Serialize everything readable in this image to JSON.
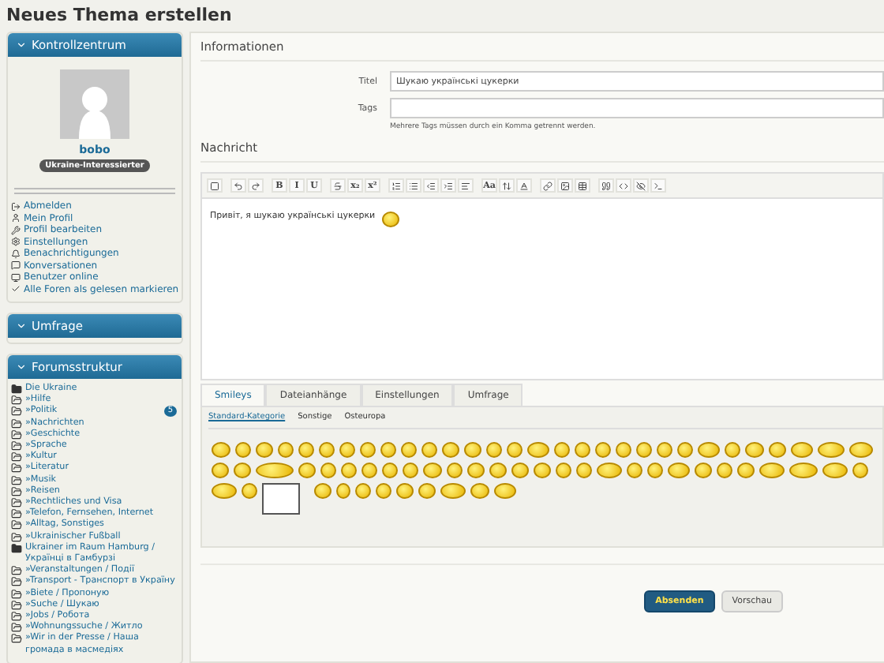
{
  "page_title": "Neues Thema erstellen",
  "control_center": {
    "title": "Kontrollzentrum",
    "username": "bobo",
    "rank": "Ukraine-Interessierter",
    "links": [
      {
        "kind": "logout",
        "label": "Abmelden"
      },
      {
        "kind": "profile",
        "label": "Mein Profil"
      },
      {
        "kind": "edit",
        "label": "Profil bearbeiten"
      },
      {
        "kind": "settings",
        "label": "Einstellungen"
      },
      {
        "kind": "bell",
        "label": "Benachrichtigungen"
      },
      {
        "kind": "chat",
        "label": "Konversationen"
      },
      {
        "kind": "monitor",
        "label": "Benutzer online"
      },
      {
        "kind": "check",
        "label": "Alle Foren als gelesen markieren"
      }
    ]
  },
  "poll_box": {
    "title": "Umfrage"
  },
  "forum_structure": {
    "title": "Forumsstruktur",
    "items": [
      {
        "label": "Die Ukraine",
        "children": [
          {
            "label": "»Hilfe"
          },
          {
            "label": "»Politik",
            "badge": "5"
          },
          {
            "label": "»Nachrichten"
          },
          {
            "label": "»Geschichte"
          },
          {
            "label": "»Sprache"
          },
          {
            "label": "»Kultur"
          },
          {
            "label": "»Literatur"
          },
          {
            "label": "»Musik"
          },
          {
            "label": "»Reisen"
          },
          {
            "label": "»Rechtliches und Visa"
          },
          {
            "label": "»Telefon, Fernsehen, Internet"
          },
          {
            "label": "»Alltag, Sonstiges"
          },
          {
            "label": "»Ukrainischer Fußball"
          }
        ]
      },
      {
        "label": "Ukrainer im Raum Hamburg / Українці в Гамбурзі",
        "children": [
          {
            "label": "»Veranstaltungen / Події"
          },
          {
            "label": "»Transport - Транспорт в Україну"
          },
          {
            "label": "»Biete / Пропоную"
          },
          {
            "label": "»Suche / Шукаю"
          },
          {
            "label": "»Jobs / Робота"
          },
          {
            "label": "»Wohnungssuche / Житло"
          },
          {
            "label": "»Wir in der Presse / Наша громада в масмедіях"
          }
        ]
      }
    ]
  },
  "information": {
    "heading": "Informationen",
    "fields": [
      {
        "label": "Titel",
        "value": "Шукаю українські цукерки"
      },
      {
        "label": "Tags"
      }
    ],
    "hint": "Mehrere Tags müssen durch ein Komma getrennt werden."
  },
  "message": {
    "heading": "Nachricht",
    "text": "Привіт, я шукаю українські цукерки",
    "toolbar": [
      [
        {
          "kind": "source"
        }
      ],
      [
        {
          "kind": "undo"
        },
        {
          "kind": "redo"
        }
      ],
      [
        {
          "kind": "text",
          "label": "B"
        },
        {
          "kind": "text",
          "label": "I"
        },
        {
          "kind": "text",
          "label": "U"
        }
      ],
      [
        {
          "kind": "strike"
        },
        {
          "kind": "text",
          "label": "x₂"
        },
        {
          "kind": "text",
          "label": "x²"
        }
      ],
      [
        {
          "kind": "list-ol"
        },
        {
          "kind": "list-ul"
        },
        {
          "kind": "outdent"
        },
        {
          "kind": "indent"
        },
        {
          "kind": "align"
        }
      ],
      [
        {
          "kind": "text",
          "label": "Aa"
        },
        {
          "kind": "color"
        },
        {
          "kind": "underline-color"
        }
      ],
      [
        {
          "kind": "link"
        },
        {
          "kind": "image"
        },
        {
          "kind": "table"
        }
      ],
      [
        {
          "kind": "quote"
        },
        {
          "kind": "code"
        },
        {
          "kind": "hide"
        },
        {
          "kind": "console"
        }
      ]
    ]
  },
  "tabs": [
    {
      "label": "Smileys",
      "selected": true
    },
    {
      "label": "Dateianhänge",
      "selected": false
    },
    {
      "label": "Einstellungen",
      "selected": false
    },
    {
      "label": "Umfrage",
      "selected": false
    }
  ],
  "smiley_categories": [
    {
      "label": "Standard-Kategorie",
      "selected": true
    },
    {
      "label": "Sonstige",
      "selected": false
    },
    {
      "label": "Osteuropa",
      "selected": false
    }
  ],
  "buttons": [
    {
      "label": "Absenden",
      "kind": "primary"
    },
    {
      "label": "Vorschau",
      "kind": "secondary"
    }
  ]
}
